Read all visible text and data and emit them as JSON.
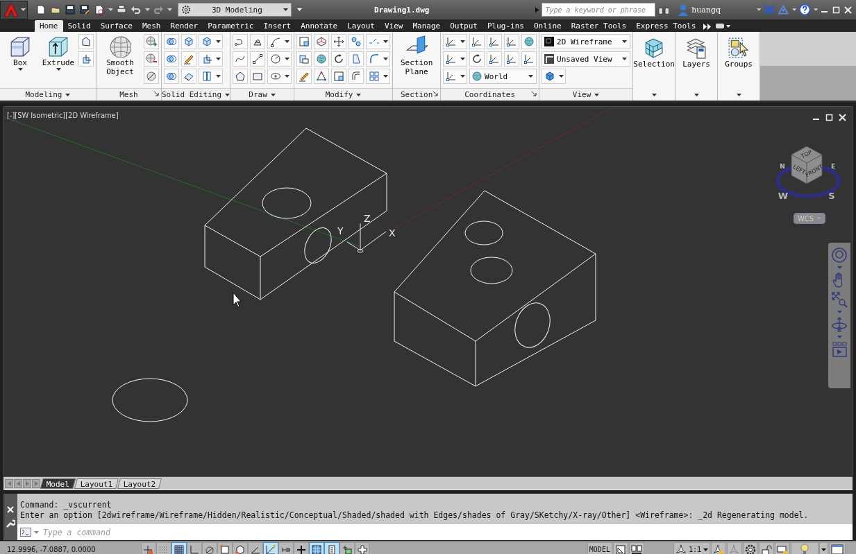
{
  "title_bar": {
    "workspace": "3D Modeling",
    "title": "Drawing1.dwg",
    "search": {
      "placeholder": "Type a keyword or phrase"
    },
    "user": "huangq"
  },
  "tabs": [
    {
      "label": "Home",
      "selected": true
    },
    {
      "label": "Solid",
      "selected": false
    },
    {
      "label": "Surface",
      "selected": false
    },
    {
      "label": "Mesh",
      "selected": false
    },
    {
      "label": "Render",
      "selected": false
    },
    {
      "label": "Parametric",
      "selected": false
    },
    {
      "label": "Insert",
      "selected": false
    },
    {
      "label": "Annotate",
      "selected": false
    },
    {
      "label": "Layout",
      "selected": false
    },
    {
      "label": "View",
      "selected": false
    },
    {
      "label": "Manage",
      "selected": false
    },
    {
      "label": "Output",
      "selected": false
    },
    {
      "label": "Plug-ins",
      "selected": false
    },
    {
      "label": "Online",
      "selected": false
    },
    {
      "label": "Raster Tools",
      "selected": false
    },
    {
      "label": "Express Tools",
      "selected": false
    }
  ],
  "ribbon": {
    "panels": [
      {
        "kind": "modeling",
        "title": "Modeling",
        "buttons": [
          "Box",
          "Extrude"
        ]
      },
      {
        "kind": "mesh",
        "title": "Mesh",
        "buttons": [
          "Smooth Object"
        ]
      },
      {
        "kind": "solid_editing",
        "title": "Solid Editing"
      },
      {
        "kind": "draw",
        "title": "Draw"
      },
      {
        "kind": "modify",
        "title": "Modify"
      },
      {
        "kind": "section",
        "title": "Section",
        "buttons": [
          "Section Plane"
        ]
      },
      {
        "kind": "coordinates",
        "title": "Coordinates",
        "combos": [
          "World"
        ]
      },
      {
        "kind": "view",
        "title": "View",
        "combos": [
          "2D Wireframe",
          "Unsaved View"
        ]
      },
      {
        "kind": "tall",
        "buttons": [
          "Selection"
        ]
      },
      {
        "kind": "tall",
        "buttons": [
          "Layers"
        ]
      },
      {
        "kind": "tall",
        "buttons": [
          "Groups"
        ]
      }
    ]
  },
  "viewport": {
    "label": "[-][SW Isometric][2D Wireframe]",
    "ucs_axes": [
      "X",
      "Y",
      "Z"
    ],
    "viewcube": {
      "faces": [
        "TOP",
        "LEFT",
        "FRONT"
      ],
      "compass": [
        "N",
        "E",
        "W",
        "S"
      ]
    },
    "ucs_menu": "WCS"
  },
  "layout_tabs": [
    {
      "label": "Model",
      "selected": true
    },
    {
      "label": "Layout1",
      "selected": false
    },
    {
      "label": "Layout2",
      "selected": false
    }
  ],
  "command": {
    "history": [
      "Command: _vscurrent",
      "Enter an option [2dwireframe/Wireframe/Hidden/Realistic/Conceptual/Shaded/shaded with Edges/shades of Gray/SKetchy/X-ray/Other] <Wireframe>: _2d Regenerating model."
    ],
    "placeholder": "Type a command"
  },
  "status_bar": {
    "coordinates": "12.9996, -7.0887, 0.0000",
    "toggles": [
      {
        "on": false
      },
      {
        "on": false
      },
      {
        "on": true
      },
      {
        "on": false
      },
      {
        "on": false
      },
      {
        "on": false
      },
      {
        "on": false
      },
      {
        "on": false
      },
      {
        "on": true
      },
      {
        "on": false
      },
      {
        "on": false
      },
      {
        "on": true
      },
      {
        "on": true
      },
      {
        "on": false
      },
      {
        "on": false
      }
    ],
    "space": "MODEL",
    "scale": "1:1"
  }
}
